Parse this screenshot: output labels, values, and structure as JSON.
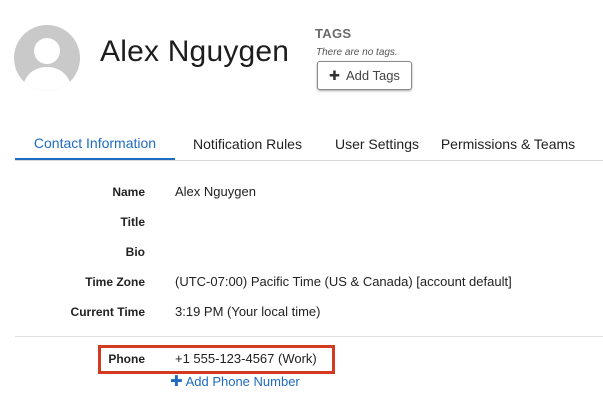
{
  "profile": {
    "name": "Alex Nguygen"
  },
  "tags": {
    "title": "TAGS",
    "empty_text": "There are no tags.",
    "add_label": "Add Tags"
  },
  "tabs": [
    {
      "label": "Contact Information",
      "active": true
    },
    {
      "label": "Notification Rules",
      "active": false
    },
    {
      "label": "User Settings",
      "active": false
    },
    {
      "label": "Permissions & Teams",
      "active": false
    }
  ],
  "contact": {
    "fields": [
      {
        "label": "Name",
        "value": "Alex Nguygen"
      },
      {
        "label": "Title",
        "value": ""
      },
      {
        "label": "Bio",
        "value": ""
      },
      {
        "label": "Time Zone",
        "value": "(UTC-07:00) Pacific Time (US & Canada) [account default]"
      },
      {
        "label": "Current Time",
        "value": "3:19 PM (Your local time)"
      }
    ],
    "phone": {
      "label": "Phone",
      "value": "+1 555-123-4567 (Work)"
    },
    "add_phone_label": "Add Phone Number"
  },
  "colors": {
    "accent": "#1f6bc1",
    "highlight": "#d43a1f",
    "avatar_bg": "#c9c9c9"
  }
}
